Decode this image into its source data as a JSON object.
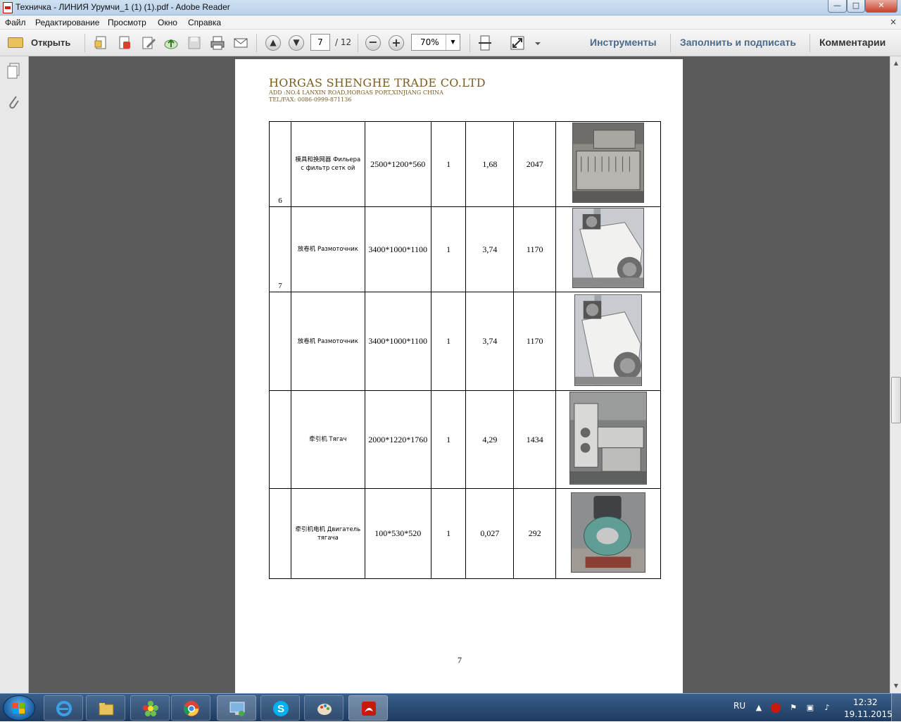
{
  "window": {
    "title": "Техничка - ЛИНИЯ Урумчи_1 (1) (1).pdf - Adobe Reader",
    "minimize_label": "—",
    "maximize_label": "□",
    "close_label": "✕"
  },
  "menu": {
    "items": [
      "Файл",
      "Редактирование",
      "Просмотр",
      "Окно",
      "Справка"
    ],
    "close_glyph": "×"
  },
  "toolbar": {
    "open_label": "Открыть",
    "page_current": "7",
    "page_total": "/ 12",
    "zoom": "70%",
    "tools_label": "Инструменты",
    "fill_sign_label": "Заполнить и подписать",
    "comments_label": "Комментарии"
  },
  "document": {
    "company": "HORGAS SHENGHE TRADE CO.LTD",
    "address": "ADD :NO.4 LANXIN ROAD,HORGAS PORT,XINJIANG CHINA",
    "telfax": "TEL/FAX: 0086-0999-871136",
    "page_number": "7",
    "rows": [
      {
        "num": "6",
        "name": "模具和换网器 Фильера с фильтр сетк ой",
        "dims": "2500*1200*560",
        "qty": "1",
        "volume": "1,68",
        "weight": "2047"
      },
      {
        "num": "7",
        "name": "放卷机 Размоточник",
        "dims": "3400*1000*1100",
        "qty": "1",
        "volume": "3,74",
        "weight": "1170"
      },
      {
        "num": "",
        "name": "放卷机 Размоточник",
        "dims": "3400*1000*1100",
        "qty": "1",
        "volume": "3,74",
        "weight": "1170"
      },
      {
        "num": "",
        "name": "牵引机 Тягач",
        "dims": "2000*1220*1760",
        "qty": "1",
        "volume": "4,29",
        "weight": "1434"
      },
      {
        "num": "",
        "name": "牵引机电机 Двигатель тягача",
        "dims": "100*530*520",
        "qty": "1",
        "volume": "0,027",
        "weight": "292"
      }
    ]
  },
  "taskbar": {
    "lang": "RU",
    "time": "12:32",
    "date": "19.11.2015"
  }
}
